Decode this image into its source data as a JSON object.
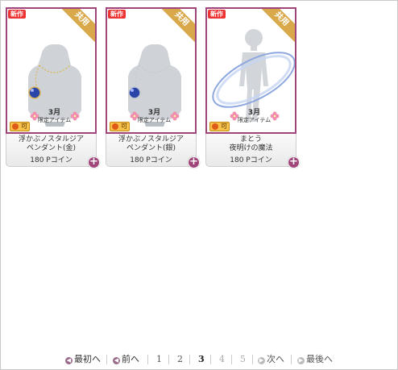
{
  "items": [
    {
      "new_badge": "新作",
      "ribbon": "共用",
      "limited_month": "3月",
      "limited_text": "限定アイテム",
      "ka_badge": "可",
      "name_line1": "浮かぶノスタルジア",
      "name_line2": "ペンダント(金)",
      "price": "180 Pコイン",
      "plus_icon": "plus-icon",
      "accent": "#d9a84a"
    },
    {
      "new_badge": "新作",
      "ribbon": "共用",
      "limited_month": "3月",
      "limited_text": "限定アイテム",
      "ka_badge": "可",
      "name_line1": "浮かぶノスタルジア",
      "name_line2": "ペンダント(銀)",
      "price": "180 Pコイン",
      "plus_icon": "plus-icon",
      "accent": "#c0c4cc"
    },
    {
      "new_badge": "新作",
      "ribbon": "共用",
      "limited_month": "3月",
      "limited_text": "限定アイテム",
      "ka_badge": "可",
      "name_line1": "まとう",
      "name_line2": "夜明けの魔法",
      "price": "180 Pコイン",
      "plus_icon": "plus-icon",
      "accent": "#9ab3e0"
    }
  ],
  "pager": {
    "first": "最初へ",
    "prev": "前へ",
    "pages": [
      "1",
      "2",
      "3",
      "4",
      "5"
    ],
    "current_page": "3",
    "next": "次へ",
    "last": "最後へ"
  },
  "colors": {
    "card_border": "#a0457a",
    "ribbon": "#d9a84a",
    "new_badge": "#e33333"
  }
}
